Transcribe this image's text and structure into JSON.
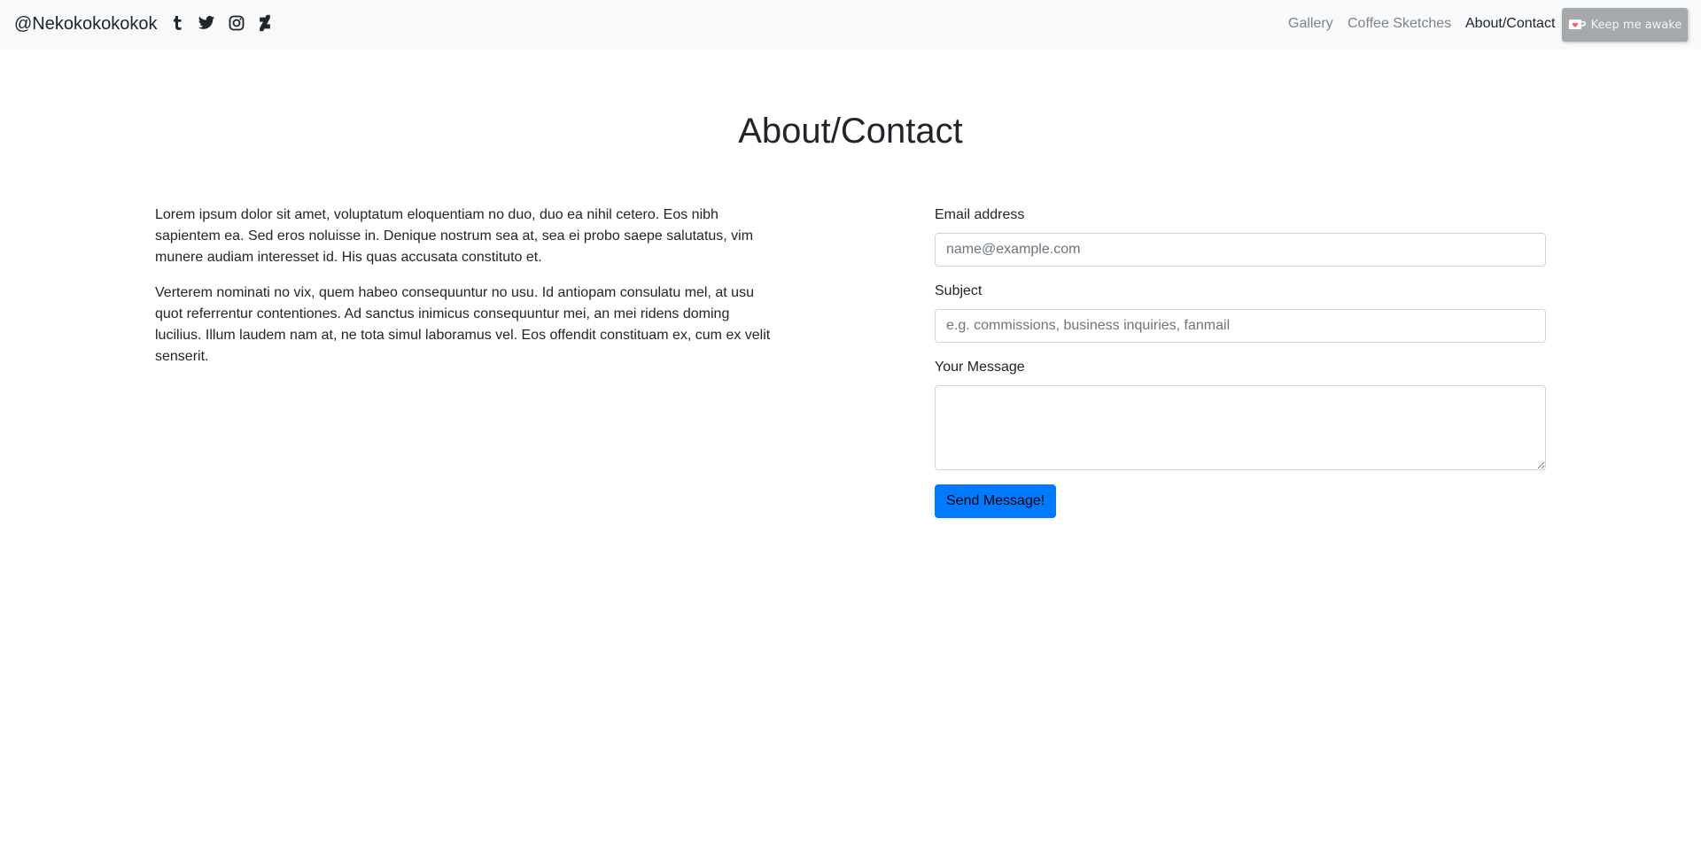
{
  "navbar": {
    "brand": "@Nekokokokokok",
    "social_icons": [
      "tumblr-icon",
      "twitter-icon",
      "instagram-icon",
      "deviantart-icon"
    ],
    "links": [
      {
        "label": "Gallery",
        "active": false
      },
      {
        "label": "Coffee Sketches",
        "active": false
      },
      {
        "label": "About/Contact",
        "active": true
      }
    ],
    "kofi_label": "Keep me awake",
    "kofi_icon": "coffee-cup-heart-icon"
  },
  "main": {
    "title": "About/Contact",
    "paragraphs": [
      "Lorem ipsum dolor sit amet, voluptatum eloquentiam no duo, duo ea nihil cetero. Eos nibh sapientem ea. Sed eros noluisse in. Denique nostrum sea at, sea ei probo saepe salutatus, vim munere audiam interesset id. His quas accusata constituto et.",
      "Verterem nominati no vix, quem habeo consequuntur no usu. Id antiopam consulatu mel, at usu quot referrentur contentiones. Ad sanctus inimicus consequuntur mei, an mei ridens doming lucilius. Illum laudem nam at, ne tota simul laboramus vel. Eos offendit constituam ex, cum ex velit senserit."
    ]
  },
  "form": {
    "email_label": "Email address",
    "email_placeholder": "name@example.com",
    "email_value": "",
    "subject_label": "Subject",
    "subject_placeholder": "e.g. commissions, business inquiries, fanmail",
    "subject_value": "",
    "message_label": "Your Message",
    "message_value": "",
    "submit_label": "Send Message!"
  },
  "colors": {
    "navbar_bg": "#f8f9fa",
    "primary": "#007bff",
    "text": "#212529",
    "muted_link": "#7f8387",
    "kofi_bg": "#a5a9ac"
  }
}
